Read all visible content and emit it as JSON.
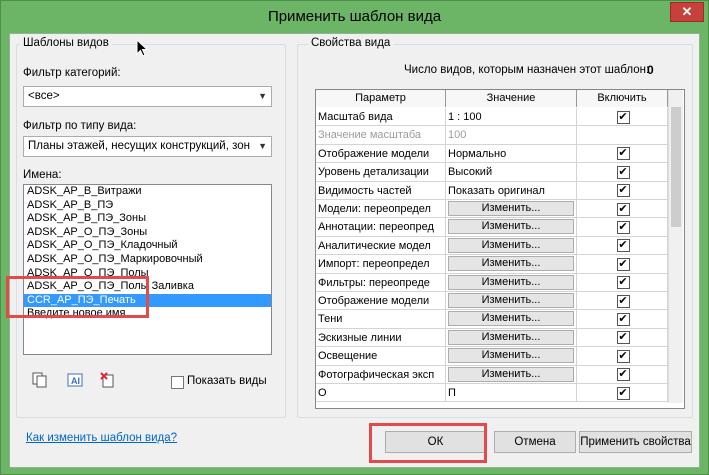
{
  "window": {
    "title": "Применить шаблон вида",
    "close_glyph": "✕"
  },
  "left": {
    "legend": "Шаблоны видов",
    "category_filter_label": "Фильтр категорий:",
    "category_filter_value": "<все>",
    "viewtype_filter_label": "Фильтр по типу вида:",
    "viewtype_filter_value": "Планы этажей, несущих конструкций, зон",
    "names_label": "Имена:",
    "names": [
      {
        "label": "ADSK_АР_В_Витражи",
        "selected": false
      },
      {
        "label": "ADSK_АР_В_ПЭ",
        "selected": false
      },
      {
        "label": "ADSK_АР_В_ПЭ_Зоны",
        "selected": false
      },
      {
        "label": "ADSK_АР_О_ПЭ_Зоны",
        "selected": false
      },
      {
        "label": "ADSK_АР_О_ПЭ_Кладочный",
        "selected": false
      },
      {
        "label": "ADSK_АР_О_ПЭ_Маркировочный",
        "selected": false
      },
      {
        "label": "ADSK_АР_О_ПЭ_Полы",
        "selected": false
      },
      {
        "label": "ADSK_АР_О_ПЭ_Полы Заливка",
        "selected": false
      },
      {
        "label": "CCR_АР_ПЭ_Печать",
        "selected": true
      },
      {
        "label": "Введите новое имя",
        "selected": false
      }
    ],
    "show_views_label": "Показать виды",
    "link": "Как изменить шаблон вида?"
  },
  "right": {
    "legend": "Свойства вида",
    "count_label": "Число видов, которым назначен этот шаблон:",
    "count_value": "0",
    "columns": [
      "Параметр",
      "Значение",
      "Включить"
    ],
    "rows": [
      {
        "param": "Масштаб вида",
        "value": "1 : 100",
        "type": "text",
        "include": true,
        "gray": false
      },
      {
        "param": "Значение масштаба",
        "value": "100",
        "type": "text",
        "include": null,
        "gray": true
      },
      {
        "param": "Отображение модели",
        "value": "Нормально",
        "type": "text",
        "include": true,
        "gray": false
      },
      {
        "param": "Уровень детализации",
        "value": "Высокий",
        "type": "text",
        "include": true,
        "gray": false
      },
      {
        "param": "Видимость частей",
        "value": "Показать оригинал",
        "type": "text",
        "include": true,
        "gray": false
      },
      {
        "param": "Модели: переопредел",
        "value": "Изменить...",
        "type": "button",
        "include": true,
        "gray": false
      },
      {
        "param": "Аннотации: переопред",
        "value": "Изменить...",
        "type": "button",
        "include": true,
        "gray": false
      },
      {
        "param": "Аналитические модел",
        "value": "Изменить...",
        "type": "button",
        "include": true,
        "gray": false
      },
      {
        "param": "Импорт: переопредел",
        "value": "Изменить...",
        "type": "button",
        "include": true,
        "gray": false
      },
      {
        "param": "Фильтры: переопреде",
        "value": "Изменить...",
        "type": "button",
        "include": true,
        "gray": false
      },
      {
        "param": "Отображение модели",
        "value": "Изменить...",
        "type": "button",
        "include": true,
        "gray": false
      },
      {
        "param": "Тени",
        "value": "Изменить...",
        "type": "button",
        "include": true,
        "gray": false
      },
      {
        "param": "Эскизные линии",
        "value": "Изменить...",
        "type": "button",
        "include": true,
        "gray": false
      },
      {
        "param": "Освещение",
        "value": "Изменить...",
        "type": "button",
        "include": true,
        "gray": false
      },
      {
        "param": "Фотографическая эксп",
        "value": "Изменить...",
        "type": "button",
        "include": true,
        "gray": false
      },
      {
        "param": "О",
        "value": "П",
        "type": "text",
        "include": true,
        "gray": false
      }
    ]
  },
  "buttons": {
    "ok": "ОК",
    "cancel": "Отмена",
    "apply": "Применить свойства"
  },
  "icons": {
    "duplicate": "duplicate-icon",
    "rename": "rename-icon",
    "delete": "delete-icon"
  }
}
